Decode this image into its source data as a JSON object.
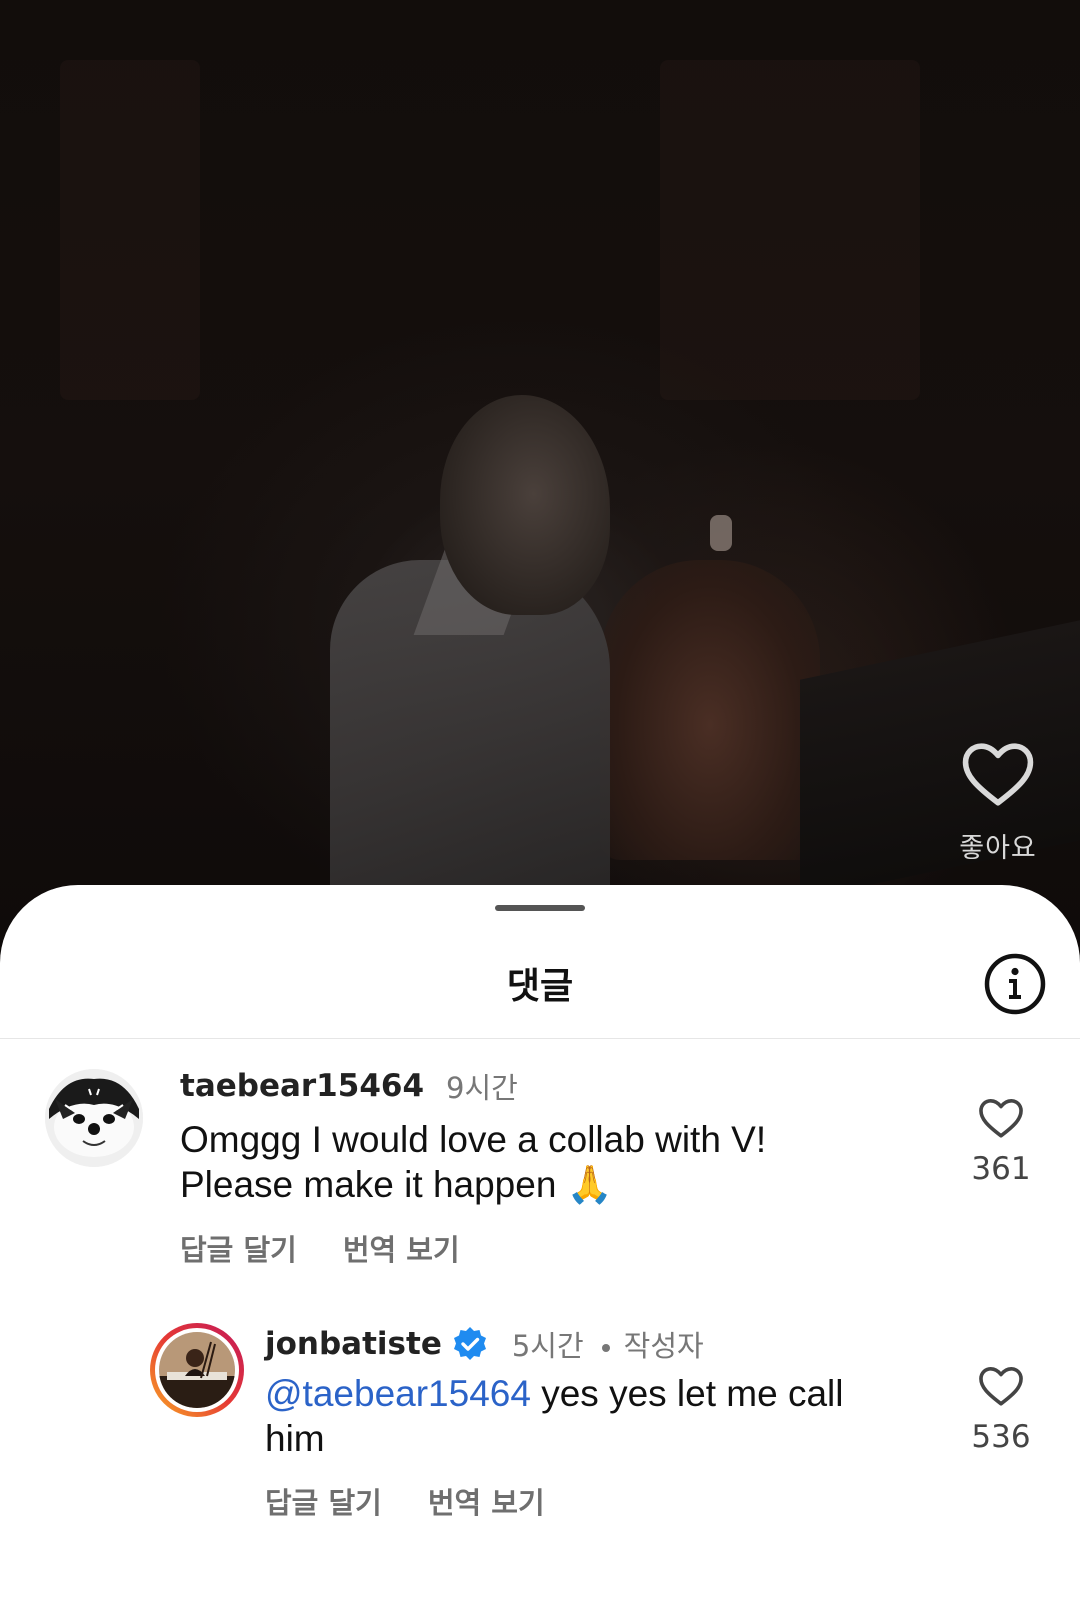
{
  "video": {
    "like_label": "좋아요",
    "like_icon": "heart-outline-icon"
  },
  "sheet": {
    "title": "댓글",
    "info_icon": "info-circle-icon"
  },
  "comments": [
    {
      "username": "taebear15464",
      "time": "9시간",
      "verified": false,
      "is_author": false,
      "text_line1": "Omggg I would love a collab with V!",
      "text_line2": "Please make it happen",
      "emoji": "🙏",
      "reply_label": "답글 달기",
      "translate_label": "번역 보기",
      "like_count": "361"
    },
    {
      "username": "jonbatiste",
      "time": "5시간",
      "verified": true,
      "is_author": true,
      "author_label": "작성자",
      "mention": "@taebear15464",
      "text_after_mention": " yes yes let me call",
      "text_line2": "him",
      "reply_label": "답글 달기",
      "translate_label": "번역 보기",
      "like_count": "536"
    }
  ],
  "colors": {
    "mention": "#2b63c8",
    "verified_badge": "#1f8bf0",
    "muted_text": "#777777",
    "story_ring_start": "#f9a825",
    "story_ring_end": "#c2185b"
  }
}
